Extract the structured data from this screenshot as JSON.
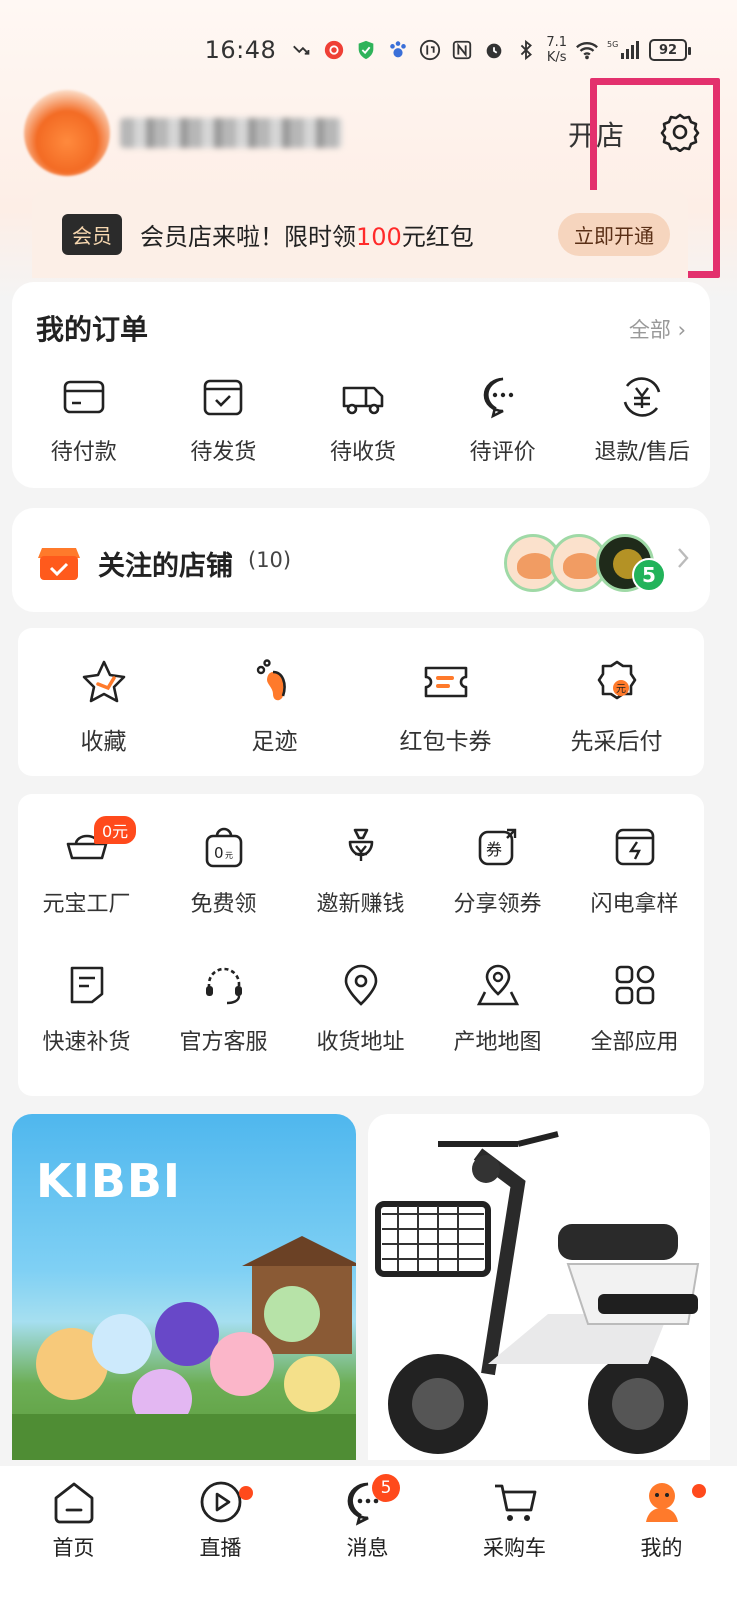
{
  "status_bar": {
    "time": "16:48",
    "net_speed_value": "7.1",
    "net_speed_unit": "K/s",
    "network": "5G",
    "battery": "92"
  },
  "header": {
    "open_shop": "开店"
  },
  "member": {
    "badge": "会员",
    "text_before": "会员店来啦！限时领",
    "amount": "100",
    "text_after": "元红包",
    "cta": "立即开通"
  },
  "orders": {
    "title": "我的订单",
    "all": "全部",
    "items": [
      {
        "label": "待付款",
        "icon": "card-icon"
      },
      {
        "label": "待发货",
        "icon": "package-icon"
      },
      {
        "label": "待收货",
        "icon": "truck-icon"
      },
      {
        "label": "待评价",
        "icon": "chat-icon"
      },
      {
        "label": "退款/售后",
        "icon": "refund-icon"
      }
    ]
  },
  "stores": {
    "title": "关注的店铺",
    "count": "(10)",
    "new_count": "5"
  },
  "shortcuts": [
    {
      "label": "收藏",
      "icon": "star-icon"
    },
    {
      "label": "足迹",
      "icon": "footprint-icon"
    },
    {
      "label": "红包卡券",
      "icon": "coupon-icon"
    },
    {
      "label": "先采后付",
      "icon": "pay-later-icon"
    }
  ],
  "apps": {
    "row1": [
      {
        "label": "元宝工厂",
        "icon": "ingot-icon",
        "tag": "0元"
      },
      {
        "label": "免费领",
        "icon": "free-bag-icon"
      },
      {
        "label": "邀新赚钱",
        "icon": "money-bag-icon"
      },
      {
        "label": "分享领券",
        "icon": "share-coupon-icon"
      },
      {
        "label": "闪电拿样",
        "icon": "lightning-icon"
      }
    ],
    "row2": [
      {
        "label": "快速补货",
        "icon": "restock-icon"
      },
      {
        "label": "官方客服",
        "icon": "headset-icon"
      },
      {
        "label": "收货地址",
        "icon": "location-icon"
      },
      {
        "label": "产地地图",
        "icon": "map-icon"
      },
      {
        "label": "全部应用",
        "icon": "apps-grid-icon"
      }
    ]
  },
  "products": {
    "left_brand": "KIBBI"
  },
  "tabbar": {
    "items": [
      {
        "label": "首页",
        "icon": "home-icon"
      },
      {
        "label": "直播",
        "icon": "live-icon"
      },
      {
        "label": "消息",
        "icon": "message-icon",
        "badge": "5"
      },
      {
        "label": "采购车",
        "icon": "cart-icon"
      },
      {
        "label": "我的",
        "icon": "profile-icon"
      }
    ]
  },
  "colors": {
    "accent": "#ff4a1c",
    "highlight": "#e3306d",
    "green_badge": "#22b35a"
  }
}
